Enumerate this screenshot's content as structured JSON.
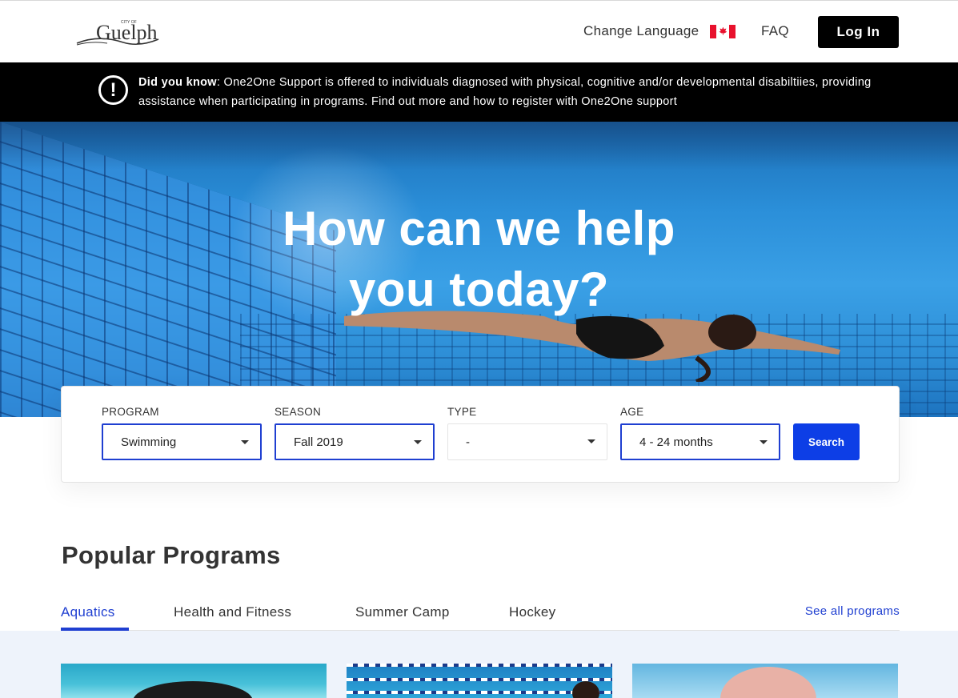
{
  "header": {
    "logo_text": "Guelph",
    "logo_small": "CITY OF",
    "change_language": "Change Language",
    "faq": "FAQ",
    "login": "Log In"
  },
  "notice": {
    "label": "Did you know",
    "text": ": One2One Support is offered to individuals diagnosed with physical, cognitive and/or developmental disabiltiies, providing assistance when participating in programs. Find out more and how to register with One2One support"
  },
  "hero": {
    "line1": "How can we help",
    "line2": "you today?"
  },
  "search": {
    "program_label": "PROGRAM",
    "program_value": "Swimming",
    "season_label": "SEASON",
    "season_value": "Fall 2019",
    "type_label": "TYPE",
    "type_value": "-",
    "age_label": "AGE",
    "age_value": "4 - 24 months",
    "button": "Search"
  },
  "popular": {
    "title": "Popular Programs",
    "tabs": [
      "Aquatics",
      "Health and Fitness",
      "Summer Camp",
      "Hockey"
    ],
    "active_tab": "Aquatics",
    "see_all": "See all programs"
  },
  "colors": {
    "accent": "#1f3fd1",
    "search_button": "#0d3ee6",
    "banner": "#000000",
    "flag_red": "#e8112d"
  }
}
